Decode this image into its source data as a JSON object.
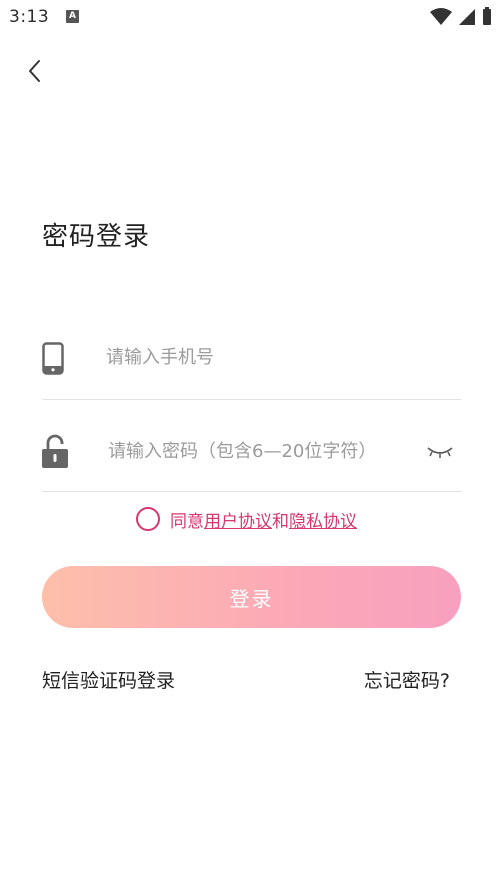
{
  "status_bar": {
    "time": "3:13",
    "notification_icon_letter": "A"
  },
  "header": {
    "back_icon": "chevron-left-icon"
  },
  "page_title": "密码登录",
  "phone_field": {
    "icon": "phone-icon",
    "placeholder": "请输入手机号",
    "value": ""
  },
  "password_field": {
    "icon": "unlock-icon",
    "placeholder": "请输入密码（包含6—20位字符）",
    "value": "",
    "toggle_icon": "eye-closed-icon"
  },
  "agreement": {
    "prefix": "同意",
    "user_agreement": "用户协议",
    "connector": "和",
    "privacy_agreement": "隐私协议",
    "checked": false,
    "accent_color": "#d7376a"
  },
  "login_button": {
    "label": "登录",
    "gradient_start": "#fdbfaa",
    "gradient_end": "#f8a0bf"
  },
  "footer_links": {
    "sms_login": "短信验证码登录",
    "forgot_password": "忘记密码?"
  }
}
